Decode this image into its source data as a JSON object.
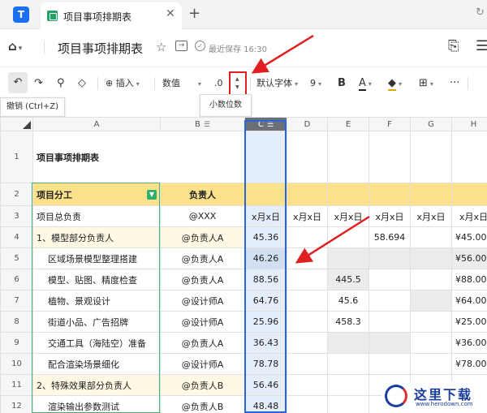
{
  "browser": {
    "tab_title": "项目事项排期表",
    "app_logo": "T",
    "close_glyph": "✕",
    "newtab_glyph": "+",
    "reload_glyph": "↻"
  },
  "docbar": {
    "home_glyph": "⌂",
    "title": "项目事项排期表",
    "save_status": "最近保存 16:30",
    "star_glyph": "☆"
  },
  "toolbar": {
    "undo_glyph": "↶",
    "redo_glyph": "↷",
    "format_painter_glyph": "⚲",
    "clear_glyph": "◇",
    "insert_label": "⊕ 插入",
    "number_format": "数值",
    "decimal_label": ".0",
    "font_name": "默认字体",
    "font_size": "9",
    "bold_glyph": "B",
    "text_color_glyph": "A",
    "fill_glyph": "◆",
    "border_glyph": "⊞",
    "more_glyph": "···",
    "dropdown_glyph": "▾",
    "up_glyph": "▲",
    "down_glyph": "▼"
  },
  "tooltips": {
    "undo": "撤销 (Ctrl+Z)",
    "decimal": "小数位数"
  },
  "sheet": {
    "columns": [
      "A",
      "B",
      "C",
      "D",
      "E",
      "F",
      "G",
      "H"
    ],
    "menu_glyph": "☰",
    "filter_glyph": "▼",
    "title": "项目事项排期表",
    "header_a": "项目分工",
    "header_b": "负责人",
    "date_label": "x月x日",
    "rows": [
      {
        "n": "1"
      },
      {
        "n": "2"
      },
      {
        "n": "3",
        "a": "项目总负责",
        "b": "@XXX"
      },
      {
        "n": "4",
        "a": "1、模型部分负责人",
        "b": "@负责人A",
        "c": "45.36",
        "f": "58.694",
        "h": "¥45.00"
      },
      {
        "n": "5",
        "a": "区域场景模型整理搭建",
        "b": "@负责人A",
        "c": "46.26",
        "h": "¥56.00"
      },
      {
        "n": "6",
        "a": "模型、贴图、精度检查",
        "b": "@负责人A",
        "c": "88.56",
        "e": "445.5",
        "h": "¥88.00"
      },
      {
        "n": "7",
        "a": "植物、景观设计",
        "b": "@设计师A",
        "c": "64.76",
        "e": "45.6",
        "h": "¥64.00"
      },
      {
        "n": "8",
        "a": "街道小品、广告招牌",
        "b": "@设计师A",
        "c": "25.96",
        "e": "458.3",
        "h": "¥25.00"
      },
      {
        "n": "9",
        "a": "交通工具（海陆空）准备",
        "b": "@负责人A",
        "c": "36.43",
        "h": "¥36.00"
      },
      {
        "n": "10",
        "a": "配合渲染场景细化",
        "b": "@设计师A",
        "c": "78.78",
        "h": "¥78.00"
      },
      {
        "n": "11",
        "a": "2、特殊效果部分负责人",
        "b": "@负责人B",
        "c": "56.46"
      },
      {
        "n": "12",
        "a": "渲染输出参数测试",
        "b": "@负责人B",
        "c": "48.48"
      }
    ]
  },
  "watermark": {
    "name": "这里下载",
    "url": "www.herodown.com"
  },
  "colors": {
    "accent": "#2a64d6",
    "highlight_red": "#e02020",
    "header_yellow": "#fbe28a"
  }
}
